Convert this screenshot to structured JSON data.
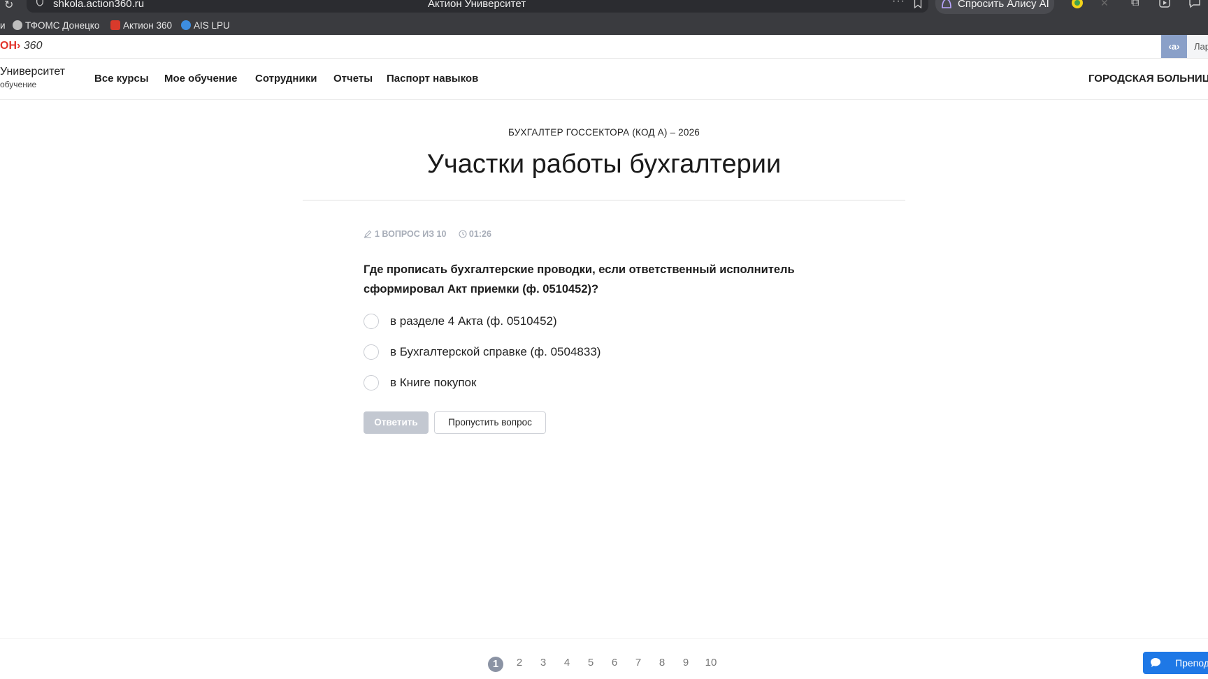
{
  "browser": {
    "url": "shkola.action360.ru",
    "tab_title": "Актион Университет",
    "alisa_label": "Спросить Алису AI",
    "bookmarks": [
      {
        "label": "ТФОМС Донецко"
      },
      {
        "label": "Актион 360"
      },
      {
        "label": "AIS LPU"
      }
    ]
  },
  "brand": {
    "logo_red": "ОН›",
    "logo_num": "360",
    "a_button": "‹а›",
    "user_label": "Лар"
  },
  "site": {
    "name": "Университет",
    "subtitle": "обучение",
    "nav": [
      "Все курсы",
      "Мое обучение",
      "Сотрудники",
      "Отчеты",
      "Паспорт навыков"
    ],
    "organization": "ГОРОДСКАЯ БОЛЬНИЦ"
  },
  "lesson": {
    "course": "БУХГАЛТЕР ГОССЕКТОРА (КОД А) – 2026",
    "title": "Участки работы бухгалтерии",
    "progress": "1 ВОПРОС ИЗ 10",
    "timer": "01:26",
    "question": "Где прописать бухгалтерские проводки, если ответственный исполнитель сформировал Акт приемки (ф. 0510452)?",
    "answers": [
      "в разделе 4 Акта (ф. 0510452)",
      "в Бухгалтерской справке (ф. 0504833)",
      "в Книге покупок"
    ],
    "submit_label": "Ответить",
    "skip_label": "Пропустить вопрос"
  },
  "pagination": {
    "pages": [
      "1",
      "2",
      "3",
      "4",
      "5",
      "6",
      "7",
      "8",
      "9",
      "10"
    ],
    "current": "1"
  },
  "teacher_button": "Препод",
  "colors": {
    "accent_blue": "#1e78e6",
    "brand_red": "#e2342b",
    "disabled_button": "#c3c8d1",
    "active_page": "#8b93a4"
  }
}
